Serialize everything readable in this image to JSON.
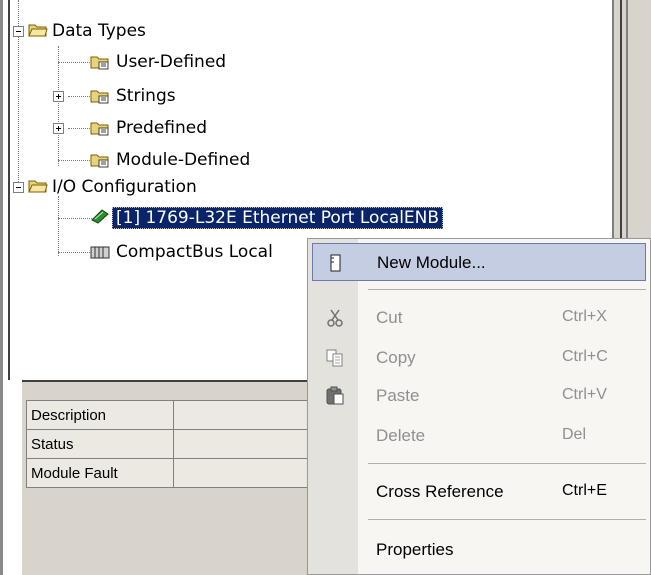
{
  "tree": {
    "nodes": [
      {
        "label": "Data Types"
      },
      {
        "label": "User-Defined"
      },
      {
        "label": "Strings"
      },
      {
        "label": "Predefined"
      },
      {
        "label": "Module-Defined"
      },
      {
        "label": "I/O Configuration"
      },
      {
        "label": "[1] 1769-L32E Ethernet Port LocalENB"
      },
      {
        "label": "CompactBus Local"
      }
    ]
  },
  "properties": {
    "rows": [
      {
        "key": "Description",
        "value": ""
      },
      {
        "key": "Status",
        "value": ""
      },
      {
        "key": "Module Fault",
        "value": ""
      }
    ]
  },
  "context_menu": {
    "items": [
      {
        "label": "New Module...",
        "shortcut": "",
        "icon": "new-module-icon"
      },
      {
        "label": "Cut",
        "shortcut": "Ctrl+X",
        "icon": "cut-icon"
      },
      {
        "label": "Copy",
        "shortcut": "Ctrl+C",
        "icon": "copy-icon"
      },
      {
        "label": "Paste",
        "shortcut": "Ctrl+V",
        "icon": "paste-icon"
      },
      {
        "label": "Delete",
        "shortcut": "Del",
        "icon": ""
      },
      {
        "label": "Cross Reference",
        "shortcut": "Ctrl+E",
        "icon": ""
      },
      {
        "label": "Properties",
        "shortcut": "",
        "icon": ""
      }
    ]
  },
  "colors": {
    "selection": "#0a246a",
    "menu_highlight": "#c5cde3",
    "panel_gray": "#d8d4cc"
  }
}
